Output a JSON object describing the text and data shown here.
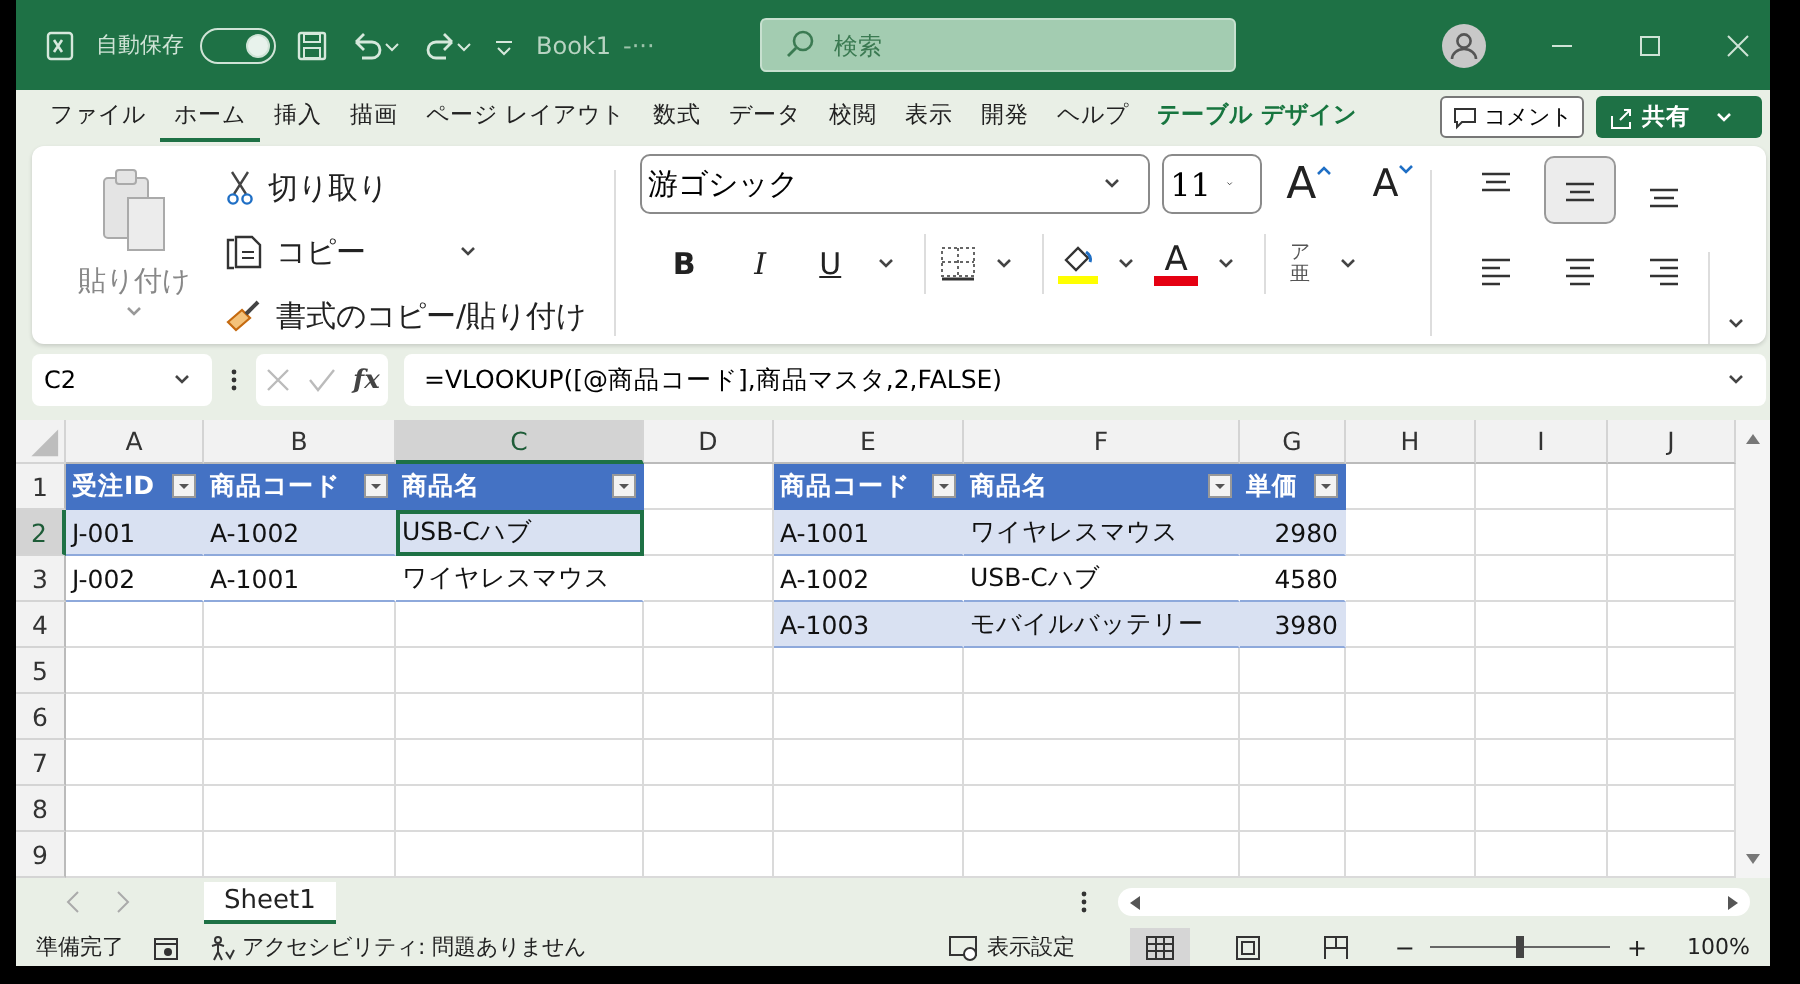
{
  "title_bar": {
    "autosave": {
      "label": "自動保存",
      "on": true
    },
    "document": "Book1",
    "document_suffix": "-···",
    "search": {
      "placeholder": "検索"
    }
  },
  "ribbon_tabs": [
    {
      "label": "ファイル",
      "selected": false,
      "kind": "standard"
    },
    {
      "label": "ホーム",
      "selected": true,
      "kind": "standard"
    },
    {
      "label": "挿入",
      "selected": false,
      "kind": "standard"
    },
    {
      "label": "描画",
      "selected": false,
      "kind": "standard"
    },
    {
      "label": "ページ レイアウト",
      "selected": false,
      "kind": "standard"
    },
    {
      "label": "数式",
      "selected": false,
      "kind": "standard"
    },
    {
      "label": "データ",
      "selected": false,
      "kind": "standard"
    },
    {
      "label": "校閲",
      "selected": false,
      "kind": "standard"
    },
    {
      "label": "表示",
      "selected": false,
      "kind": "standard"
    },
    {
      "label": "開発",
      "selected": false,
      "kind": "standard"
    },
    {
      "label": "ヘルプ",
      "selected": false,
      "kind": "standard"
    },
    {
      "label": "テーブル デザイン",
      "selected": false,
      "kind": "contextual"
    }
  ],
  "comment_button": "コメント",
  "share_button": "共有",
  "clipboard": {
    "paste": "貼り付け",
    "cut": "切り取り",
    "copy": "コピー",
    "format_painter": "書式のコピー/貼り付け"
  },
  "font": {
    "name": "游ゴシック",
    "size": "11",
    "grow": "A",
    "shrink": "A",
    "bold": "B",
    "italic": "I",
    "underline": "U",
    "font_color": "A",
    "phonetic_top": "ア",
    "phonetic_bottom": "亜"
  },
  "alignment": [
    {
      "kind": "top",
      "selected": false
    },
    {
      "kind": "middle",
      "selected": true
    },
    {
      "kind": "bottom",
      "selected": false
    },
    {
      "kind": "left",
      "selected": false
    },
    {
      "kind": "center",
      "selected": false
    },
    {
      "kind": "right",
      "selected": false
    }
  ],
  "formula_bar": {
    "name_box": "C2",
    "fx": "fx",
    "formula": "=VLOOKUP([@商品コード],商品マスタ,2,FALSE)"
  },
  "sheet": {
    "columns": [
      {
        "label": "A",
        "selected": false
      },
      {
        "label": "B",
        "selected": false
      },
      {
        "label": "C",
        "selected": true
      },
      {
        "label": "D",
        "selected": false
      },
      {
        "label": "E",
        "selected": false
      },
      {
        "label": "F",
        "selected": false
      },
      {
        "label": "G",
        "selected": false
      },
      {
        "label": "H",
        "selected": false
      },
      {
        "label": "I",
        "selected": false
      },
      {
        "label": "J",
        "selected": false
      }
    ],
    "rows": [
      {
        "header": "1",
        "selected": false,
        "cells": [
          {
            "kind": "header",
            "text": "受注ID",
            "selected": false
          },
          {
            "kind": "header",
            "text": "商品コード",
            "selected": false
          },
          {
            "kind": "header",
            "text": "商品名",
            "selected": false
          },
          {
            "kind": "empty",
            "selected": false
          },
          {
            "kind": "header",
            "text": "商品コード",
            "selected": false
          },
          {
            "kind": "header",
            "text": "商品名",
            "selected": false
          },
          {
            "kind": "header",
            "text": "単価",
            "selected": false
          }
        ]
      },
      {
        "header": "2",
        "selected": true,
        "cells": [
          {
            "kind": "band",
            "text": "J-001",
            "selected": false
          },
          {
            "kind": "band",
            "text": "A-1002",
            "selected": false
          },
          {
            "kind": "band",
            "text": "USB-Cハブ",
            "selected": true
          },
          {
            "kind": "empty",
            "selected": false
          },
          {
            "kind": "band",
            "text": "A-1001",
            "selected": false
          },
          {
            "kind": "band",
            "text": "ワイヤレスマウス",
            "selected": false
          },
          {
            "kind": "band_number",
            "text": "2980",
            "selected": false
          }
        ]
      },
      {
        "header": "3",
        "selected": false,
        "cells": [
          {
            "kind": "plain",
            "text": "J-002",
            "selected": false
          },
          {
            "kind": "plain",
            "text": "A-1001",
            "selected": false
          },
          {
            "kind": "plain",
            "text": "ワイヤレスマウス",
            "selected": false
          },
          {
            "kind": "empty",
            "selected": false
          },
          {
            "kind": "plain",
            "text": "A-1002",
            "selected": false
          },
          {
            "kind": "plain",
            "text": "USB-Cハブ",
            "selected": false
          },
          {
            "kind": "plain_number",
            "text": "4580",
            "selected": false
          }
        ]
      },
      {
        "header": "4",
        "selected": false,
        "cells": [
          {
            "kind": "empty",
            "selected": false
          },
          {
            "kind": "empty",
            "selected": false
          },
          {
            "kind": "empty",
            "selected": false
          },
          {
            "kind": "empty",
            "selected": false
          },
          {
            "kind": "band",
            "text": "A-1003",
            "selected": false
          },
          {
            "kind": "band",
            "text": "モバイルバッテリー",
            "selected": false
          },
          {
            "kind": "band_number",
            "text": "3980",
            "selected": false
          }
        ]
      },
      {
        "header": "5",
        "selected": false
      },
      {
        "header": "6",
        "selected": false
      },
      {
        "header": "7",
        "selected": false
      },
      {
        "header": "8",
        "selected": false
      },
      {
        "header": "9",
        "selected": false
      }
    ]
  },
  "sheet_tabs": [
    {
      "label": "Sheet1",
      "selected": true
    }
  ],
  "status_bar": {
    "ready": "準備完了",
    "accessibility": "アクセシビリティ: 問題ありません",
    "display_settings": "表示設定",
    "views": [
      {
        "kind": "normal",
        "selected": true
      },
      {
        "kind": "page_layout",
        "selected": false
      },
      {
        "kind": "page_break",
        "selected": false
      }
    ],
    "zoom": {
      "minus": "−",
      "plus": "+",
      "level": 0.5,
      "reading": "100%"
    }
  }
}
